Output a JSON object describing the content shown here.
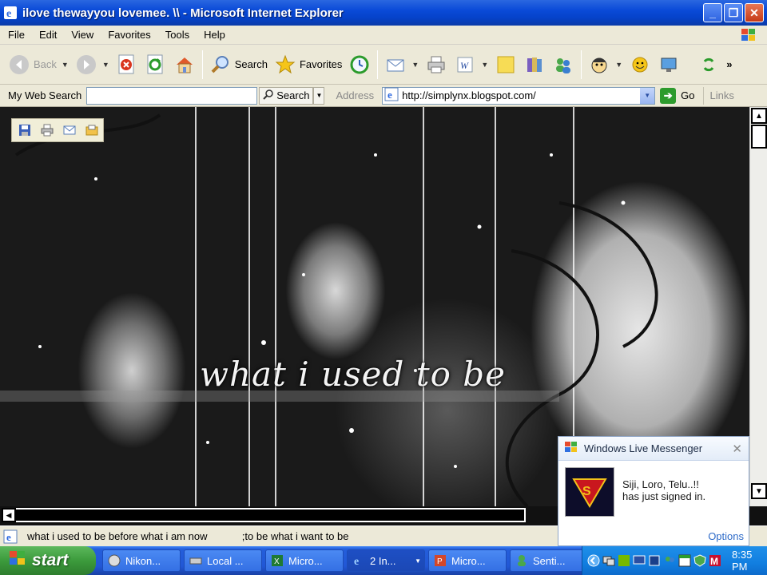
{
  "window": {
    "title": "ilove thewayyou lovemee. \\\\ - Microsoft Internet Explorer",
    "minimize": "_",
    "maximize": "❐",
    "close": "✕"
  },
  "menu": [
    "File",
    "Edit",
    "View",
    "Favorites",
    "Tools",
    "Help"
  ],
  "toolbar": {
    "back_label": "Back",
    "search_label": "Search",
    "favorites_label": "Favorites",
    "overflow": "»"
  },
  "search_bar": {
    "label": "My Web Search",
    "value": "",
    "button_label": "Search"
  },
  "address_bar": {
    "label": "Address",
    "url": "http://simplynx.blogspot.com/",
    "go_label": "Go",
    "links_label": "Links"
  },
  "page": {
    "banner_title": "what i used to be"
  },
  "status_bar": {
    "text": "what i used to be before what i am now            ;to be what i want to be"
  },
  "taskbar": {
    "start_label": "start",
    "tasks": [
      {
        "label": "Nikon...",
        "icon": "nikon-icon"
      },
      {
        "label": "Local ...",
        "icon": "drive-icon"
      },
      {
        "label": "Micro...",
        "icon": "excel-icon"
      },
      {
        "label": "2 In...",
        "icon": "ie-icon",
        "active": true
      },
      {
        "label": "Micro...",
        "icon": "powerpoint-icon"
      },
      {
        "label": "Senti...",
        "icon": "messenger-user-icon"
      }
    ],
    "clock": "8:35 PM"
  },
  "messenger_popup": {
    "title": "Windows Live Messenger",
    "message_line1": "Siji, Loro, Telu..!!",
    "message_line2": "has just signed in.",
    "options_label": "Options"
  },
  "colors": {
    "xp_blue": "#0a4ad8",
    "start_green": "#3c9b3c",
    "chrome": "#ece9d8"
  }
}
